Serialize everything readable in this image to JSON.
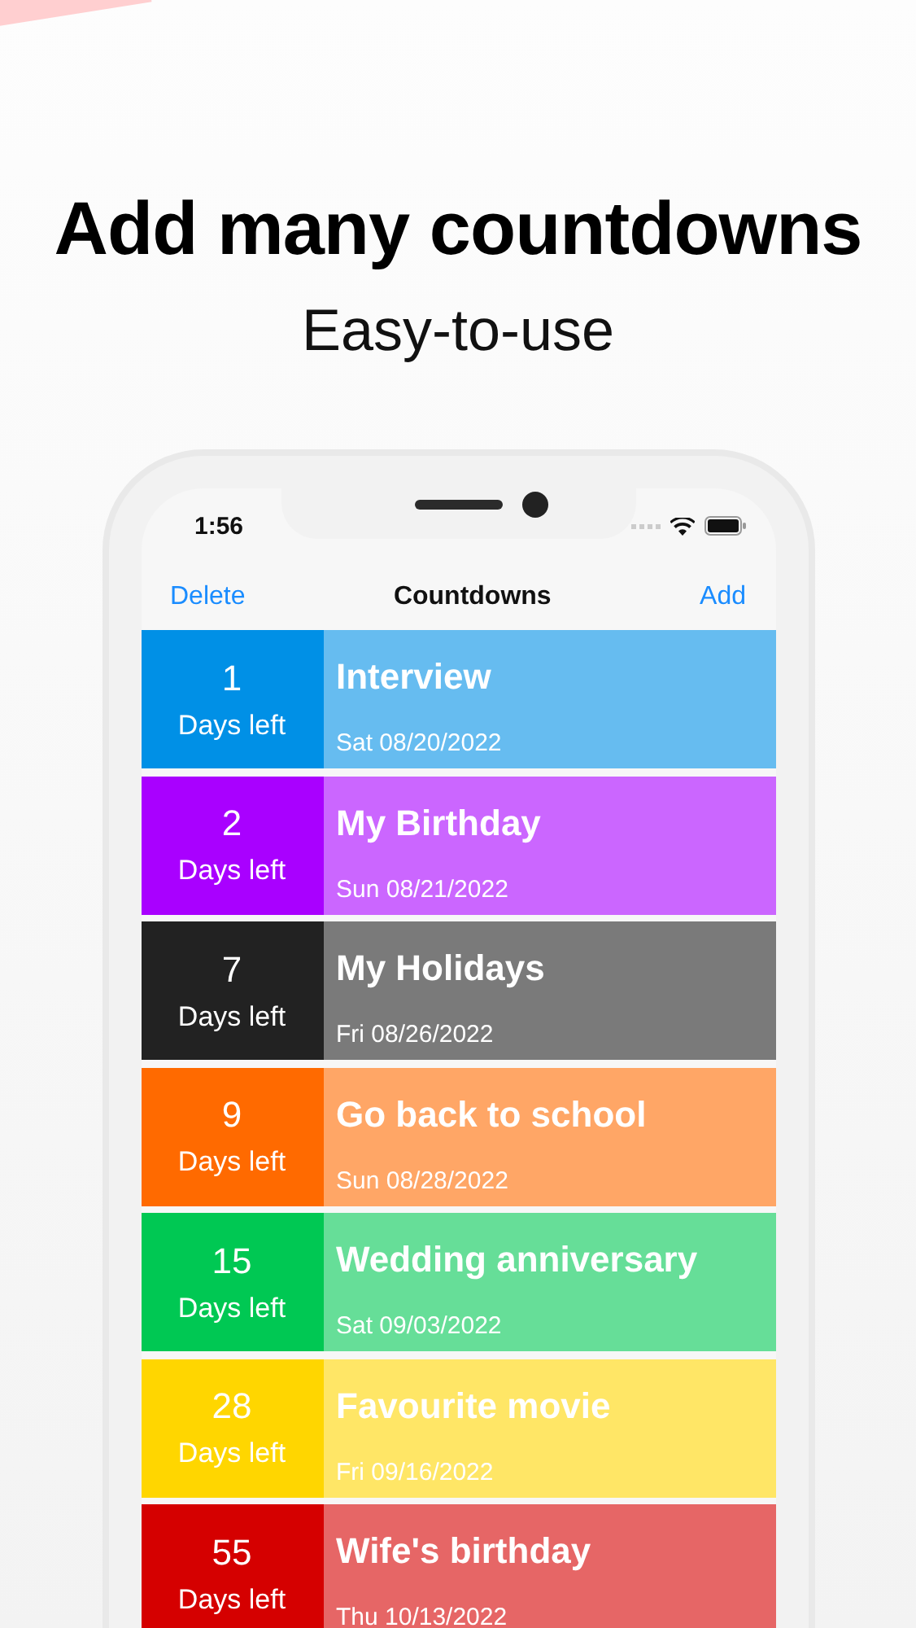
{
  "headline": "Add many countdowns",
  "subtitle": "Easy-to-use",
  "status_bar": {
    "time": "1:56"
  },
  "nav": {
    "left": "Delete",
    "title": "Countdowns",
    "right": "Add"
  },
  "countdowns": [
    {
      "days": "1",
      "unit": "Days left",
      "title": "Interview",
      "date": "Sat 08/20/2022",
      "color": "#0090e6"
    },
    {
      "days": "2",
      "unit": "Days left",
      "title": "My Birthday",
      "date": "Sun 08/21/2022",
      "color": "#a900ff"
    },
    {
      "days": "7",
      "unit": "Days left",
      "title": "My Holidays",
      "date": "Fri 08/26/2022",
      "color": "#222222"
    },
    {
      "days": "9",
      "unit": "Days left",
      "title": "Go back to school",
      "date": "Sun 08/28/2022",
      "color": "#ff6a00"
    },
    {
      "days": "15",
      "unit": "Days left",
      "title": "Wedding anniversary",
      "date": "Sat 09/03/2022",
      "color": "#00c853"
    },
    {
      "days": "28",
      "unit": "Days left",
      "title": "Favourite movie",
      "date": "Fri 09/16/2022",
      "color": "#ffd600"
    },
    {
      "days": "55",
      "unit": "Days left",
      "title": "Wife's birthday",
      "date": "Thu 10/13/2022",
      "color": "#d50000"
    }
  ]
}
